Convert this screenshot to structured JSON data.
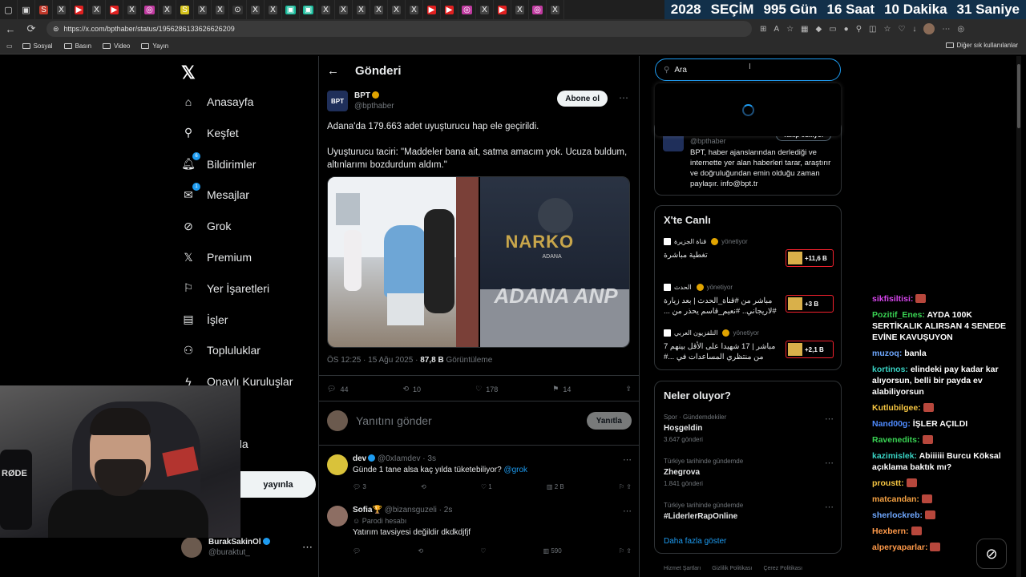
{
  "browser": {
    "url": "https://x.com/bpthaber/status/1956286133626626209",
    "bookmarks": [
      "Sosyal",
      "Basın",
      "Video",
      "Yayın"
    ],
    "bookmarks_right": "Diğer sık kullanılanlar",
    "tabs": [
      "S",
      "X",
      "▶",
      "X",
      "▶",
      "X",
      "◎",
      "X",
      "S",
      "X",
      "X",
      "⊙",
      "X",
      "X",
      "▣",
      "▣",
      "X",
      "X",
      "X",
      "X",
      "X",
      "X",
      "▶",
      "▶",
      "◎",
      "X",
      "▶",
      "X",
      "◎",
      "X"
    ]
  },
  "timer": {
    "year": "2028",
    "label": "SEÇİM",
    "days": "995 Gün",
    "hours": "16 Saat",
    "minutes": "10 Dakika",
    "seconds": "31 Saniye"
  },
  "nav": {
    "items": [
      {
        "label": "Anasayfa",
        "icon": "home-icon"
      },
      {
        "label": "Keşfet",
        "icon": "search-icon"
      },
      {
        "label": "Bildirimler",
        "icon": "bell-icon",
        "badge": "6"
      },
      {
        "label": "Mesajlar",
        "icon": "mail-icon",
        "badge": "1"
      },
      {
        "label": "Grok",
        "icon": "grok-icon"
      },
      {
        "label": "Premium",
        "icon": "x-icon"
      },
      {
        "label": "Yer İşaretleri",
        "icon": "bookmark-icon"
      },
      {
        "label": "İşler",
        "icon": "briefcase-icon"
      },
      {
        "label": "Topluluklar",
        "icon": "people-icon"
      },
      {
        "label": "Onaylı Kuruluşlar",
        "icon": "lightning-icon"
      }
    ],
    "more_fragment": "azla",
    "post_fragment": "yayınla",
    "me_name": "BurakSakinOl",
    "me_handle": "@buraktut_"
  },
  "center": {
    "header": "Gönderi",
    "author_name": "BPT",
    "author_handle": "@bpthaber",
    "follow": "Abone ol",
    "text_1": "Adana'da 179.663 adet uyuşturucu hap ele geçirildi.",
    "text_2": "Uyuşturucu taciri: \"Maddeler bana ait, satma amacım yok. Ucuza buldum, altınlarımı bozdurdum aldım.\"",
    "photo_text_narko": "NARKO",
    "photo_text_adana": "ADANA",
    "photo_text_big": "ADANA ANP",
    "time": "ÖS 12:25 · 15 Ağu 2025 · ",
    "views": "87,8 B",
    "views_label": " Görüntüleme",
    "replies": "44",
    "reposts": "10",
    "likes": "178",
    "bookmarks": "14",
    "reply_placeholder": "Yanıtını gönder",
    "reply_button": "Yanıtla",
    "replies_list": [
      {
        "name": "dev",
        "handle": "@0xIamdev · 3s",
        "text": "Günde 1 tane alsa kaç yılda tüketebiliyor?",
        "mention": "@grok",
        "replies": "3",
        "likes": "1",
        "views": "2 B",
        "parody": ""
      },
      {
        "name": "Sofia🏆",
        "handle": "@bizansguzeli · 2s",
        "text": "Yatırım tavsiyesi değildir dkdkdjfjf",
        "mention": "",
        "replies": "",
        "likes": "",
        "views": "590",
        "parody": "Parodi hesabı"
      }
    ]
  },
  "right": {
    "search_value": "Ara",
    "about_handle": "@bpthaber",
    "about_follow": "Takip ediliyor",
    "about_desc": "BPT, haber ajanslarından derlediği ve internette yer alan haberleri tarar, araştırır ve doğruluğundan emin olduğu zaman paylaşır. info@bpt.tr",
    "live_title": "X'te Canlı",
    "live": [
      {
        "source": "قناة الجزيرة",
        "status": "yönetiyor",
        "title": "تغطية مباشرة",
        "count": "+11,6 B"
      },
      {
        "source": "الحدث",
        "status": "yönetiyor",
        "title": "مباشر من #قناة_الحدث | بعد زيارة #لاريجاني.. #نعيم_قاسم يحذر من ...",
        "count": "+3 B"
      },
      {
        "source": "التلفزيون العربي",
        "status": "yönetiyor",
        "title": "مباشر | 17 شهيدا على الأقل بينهم 7 من منتظري المساعدات في ...#",
        "count": "+2,1 B"
      }
    ],
    "trends_title": "Neler oluyor?",
    "trends": [
      {
        "category": "Spor · Gündemdekiler",
        "name": "Hoşgeldin",
        "count": "3.647 gönderi"
      },
      {
        "category": "Türkiye tarihinde gündemde",
        "name": "Zhegrova",
        "count": "1.841 gönderi"
      },
      {
        "category": "Türkiye tarihinde gündemde",
        "name": "#LiderlerRapOnline",
        "count": ""
      }
    ],
    "show_more": "Daha fazla göster",
    "footer": [
      "Hizmet Şartları",
      "Gizlilik Politikası",
      "Çerez Politikası"
    ]
  },
  "webcam": {
    "mic_brand": "RØDE"
  },
  "chat": [
    {
      "user": "sikfisiltisi:",
      "text": "",
      "color": "#d946ef"
    },
    {
      "user": "Pozitif_Enes:",
      "text": " AYDA 100K SERTİKALIK ALIRSAN 4 SENEDE EVİNE KAVUŞUYON",
      "color": "#39d353"
    },
    {
      "user": "muzoq:",
      "text": " banla",
      "color": "#6fa8ff"
    },
    {
      "user": "kortinos:",
      "text": " elindeki pay kadar kar alıyorsun, belli bir payda ev alabiliyorsun",
      "color": "#39d3c4"
    },
    {
      "user": "Kutlubilgee:",
      "text": "",
      "color": "#f5c542"
    },
    {
      "user": "Nand00g:",
      "text": " İŞLER AÇILDI",
      "color": "#4f8bff"
    },
    {
      "user": "Ravenedits:",
      "text": "",
      "color": "#39d353"
    },
    {
      "user": "kazimislek:",
      "text": " Abiiiiii Burcu Köksal açıklama baktık mı?",
      "color": "#39d3c4"
    },
    {
      "user": "proustt:",
      "text": "",
      "color": "#f5c542"
    },
    {
      "user": "matcandan:",
      "text": "",
      "color": "#f5a142"
    },
    {
      "user": "sherlockreb:",
      "text": "",
      "color": "#6fa8ff"
    },
    {
      "user": "Hexbern:",
      "text": "",
      "color": "#ff9a4a"
    },
    {
      "user": "alperyaparlar:",
      "text": "",
      "color": "#ff9a4a"
    }
  ]
}
